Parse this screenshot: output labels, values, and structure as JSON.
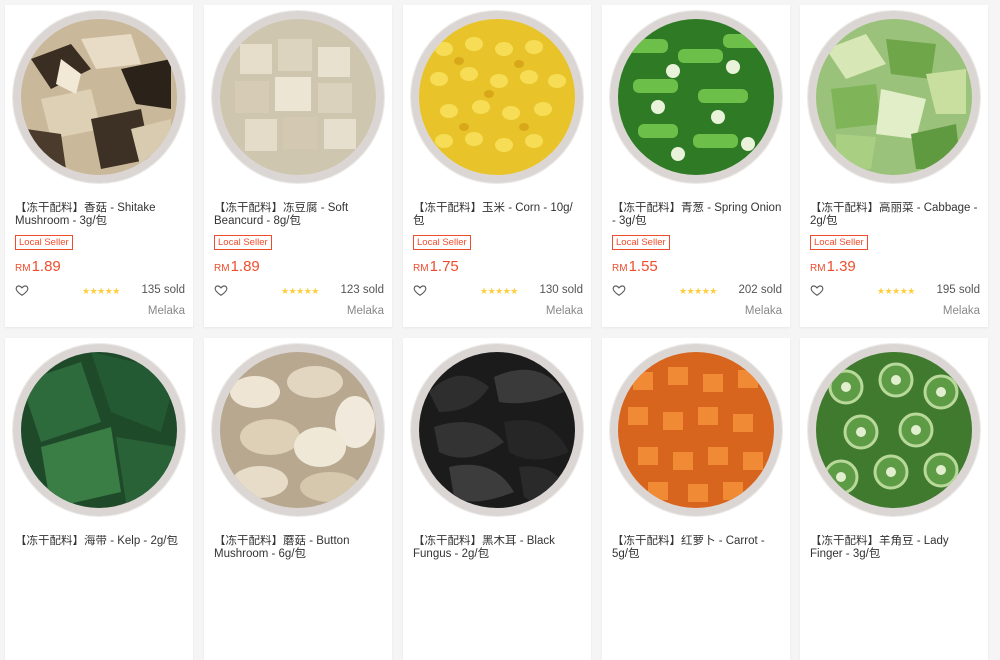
{
  "products": [
    {
      "title": "【冻干配料】香菇 - Shitake Mushroom - 3g/包",
      "badge": "Local Seller",
      "currency": "RM",
      "price": "1.89",
      "stars": "★★★★★",
      "sold": "135 sold",
      "location": "Melaka",
      "image": "shiitake-mushroom-image"
    },
    {
      "title": "【冻干配料】冻豆腐 - Soft Beancurd - 8g/包",
      "badge": "Local Seller",
      "currency": "RM",
      "price": "1.89",
      "stars": "★★★★★",
      "sold": "123 sold",
      "location": "Melaka",
      "image": "beancurd-image"
    },
    {
      "title": "【冻干配料】玉米 - Corn - 10g/包",
      "badge": "Local Seller",
      "currency": "RM",
      "price": "1.75",
      "stars": "★★★★★",
      "sold": "130 sold",
      "location": "Melaka",
      "image": "corn-image"
    },
    {
      "title": "【冻干配料】青葱 - Spring Onion - 3g/包",
      "badge": "Local Seller",
      "currency": "RM",
      "price": "1.55",
      "stars": "★★★★★",
      "sold": "202 sold",
      "location": "Melaka",
      "image": "spring-onion-image"
    },
    {
      "title": "【冻干配料】高丽菜 - Cabbage - 2g/包",
      "badge": "Local Seller",
      "currency": "RM",
      "price": "1.39",
      "stars": "★★★★★",
      "sold": "195 sold",
      "location": "Melaka",
      "image": "cabbage-image"
    },
    {
      "title": "【冻干配料】海带 - Kelp - 2g/包",
      "image": "kelp-image"
    },
    {
      "title": "【冻干配料】蘑菇 - Button Mushroom - 6g/包",
      "image": "button-mushroom-image"
    },
    {
      "title": "【冻干配料】黑木耳 - Black Fungus - 2g/包",
      "image": "black-fungus-image"
    },
    {
      "title": "【冻干配料】红萝卜 - Carrot - 5g/包",
      "image": "carrot-image"
    },
    {
      "title": "【冻干配料】羊角豆 - Lady Finger - 3g/包",
      "image": "lady-finger-image"
    }
  ],
  "colors": {
    "accent": "#ee4d2d",
    "star": "#ffce3d"
  }
}
